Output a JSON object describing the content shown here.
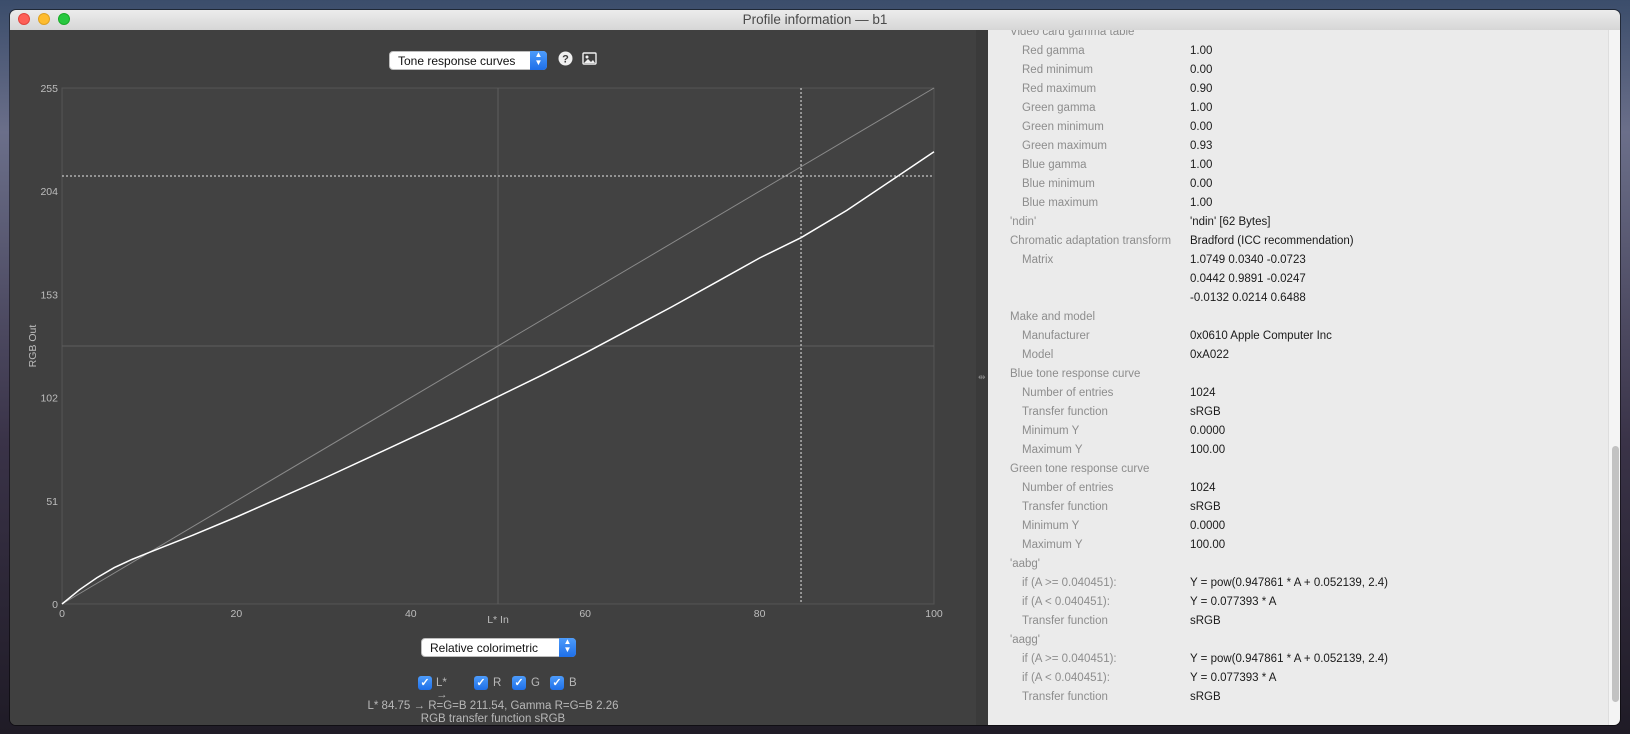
{
  "window": {
    "title": "Profile information — b1"
  },
  "toolbar": {
    "view_select": "Tone response curves",
    "help_icon": "help-icon",
    "image_icon": "save-image-icon"
  },
  "chart_data": {
    "type": "line",
    "xlabel": "L* In",
    "ylabel": "RGB Out",
    "xlim": [
      0,
      100
    ],
    "ylim": [
      0,
      255
    ],
    "x_ticks": [
      "0",
      "20",
      "40",
      "60",
      "80",
      "100"
    ],
    "y_ticks": [
      "0",
      "51",
      "102",
      "153",
      "204",
      "255"
    ],
    "grid": "center lines",
    "series": [
      {
        "color": "#ffffff",
        "x": [
          0,
          2,
          4,
          6,
          8,
          10,
          15,
          20,
          25,
          30,
          35,
          40,
          45,
          50,
          55,
          60,
          65,
          70,
          75,
          80,
          84.75,
          90,
          95,
          100
        ],
        "y": [
          0,
          7,
          13,
          18,
          22,
          25.5,
          34,
          43,
          52.5,
          62,
          72,
          82,
          92,
          102.5,
          113,
          124,
          135.5,
          147,
          159,
          171,
          181,
          194.5,
          209,
          223.5
        ]
      },
      {
        "color": "#8a8a8a",
        "x": [
          0,
          100
        ],
        "y": [
          0,
          255
        ]
      }
    ],
    "crosshair": {
      "x": 84.75,
      "y": 211.54
    }
  },
  "intent_select": "Relative colorimetric",
  "checkboxes": {
    "lstar": "L* →",
    "r": "R",
    "g": "G",
    "b": "B"
  },
  "readout": {
    "line1": "L* 84.75 → R=G=B 211.54, Gamma R=G=B 2.26",
    "line2": "RGB transfer function sRGB"
  },
  "info_rows": [
    {
      "k": "Video card gamma table",
      "v": "",
      "indent": 0
    },
    {
      "k": "Red gamma",
      "v": "1.00",
      "indent": 1
    },
    {
      "k": "Red minimum",
      "v": "0.00",
      "indent": 1
    },
    {
      "k": "Red maximum",
      "v": "0.90",
      "indent": 1
    },
    {
      "k": "Green gamma",
      "v": "1.00",
      "indent": 1
    },
    {
      "k": "Green minimum",
      "v": "0.00",
      "indent": 1
    },
    {
      "k": "Green maximum",
      "v": "0.93",
      "indent": 1
    },
    {
      "k": "Blue gamma",
      "v": "1.00",
      "indent": 1
    },
    {
      "k": "Blue minimum",
      "v": "0.00",
      "indent": 1
    },
    {
      "k": "Blue maximum",
      "v": "1.00",
      "indent": 1
    },
    {
      "k": "'ndin'",
      "v": "'ndin' [62 Bytes]",
      "indent": 0
    },
    {
      "k": "Chromatic adaptation transform",
      "v": "Bradford (ICC recommendation)",
      "indent": 0
    },
    {
      "k": "Matrix",
      "v": "1.0749 0.0340 -0.0723",
      "indent": 1
    },
    {
      "k": "",
      "v": "0.0442 0.9891 -0.0247",
      "indent": 1
    },
    {
      "k": "",
      "v": "-0.0132 0.0214 0.6488",
      "indent": 1
    },
    {
      "k": "Make and model",
      "v": "",
      "indent": 0
    },
    {
      "k": "Manufacturer",
      "v": "0x0610 Apple Computer Inc",
      "indent": 1
    },
    {
      "k": "Model",
      "v": "0xA022",
      "indent": 1
    },
    {
      "k": "Blue tone response curve",
      "v": "",
      "indent": 0
    },
    {
      "k": "Number of entries",
      "v": "1024",
      "indent": 1
    },
    {
      "k": "Transfer function",
      "v": "sRGB",
      "indent": 1
    },
    {
      "k": "Minimum Y",
      "v": "0.0000",
      "indent": 1
    },
    {
      "k": "Maximum Y",
      "v": "100.00",
      "indent": 1
    },
    {
      "k": "Green tone response curve",
      "v": "",
      "indent": 0
    },
    {
      "k": "Number of entries",
      "v": "1024",
      "indent": 1
    },
    {
      "k": "Transfer function",
      "v": "sRGB",
      "indent": 1
    },
    {
      "k": "Minimum Y",
      "v": "0.0000",
      "indent": 1
    },
    {
      "k": "Maximum Y",
      "v": "100.00",
      "indent": 1
    },
    {
      "k": "'aabg'",
      "v": "",
      "indent": 0
    },
    {
      "k": "if (A >= 0.040451):",
      "v": "Y = pow(0.947861 * A + 0.052139, 2.4)",
      "indent": 1
    },
    {
      "k": "if (A <  0.040451):",
      "v": "Y = 0.077393 * A",
      "indent": 1
    },
    {
      "k": "Transfer function",
      "v": "sRGB",
      "indent": 1
    },
    {
      "k": "'aagg'",
      "v": "",
      "indent": 0
    },
    {
      "k": "if (A >= 0.040451):",
      "v": "Y = pow(0.947861 * A + 0.052139, 2.4)",
      "indent": 1
    },
    {
      "k": "if (A <  0.040451):",
      "v": "Y = 0.077393 * A",
      "indent": 1
    },
    {
      "k": "Transfer function",
      "v": "sRGB",
      "indent": 1
    }
  ]
}
